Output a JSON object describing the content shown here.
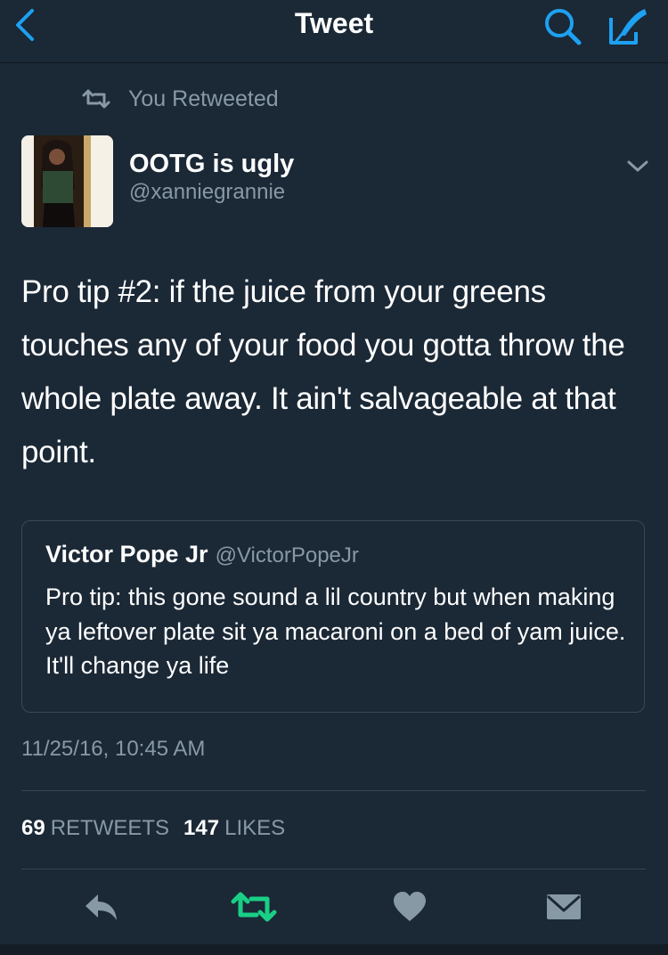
{
  "nav": {
    "title": "Tweet",
    "back_icon": "chevron-left-icon",
    "search_icon": "search-icon",
    "compose_icon": "compose-icon"
  },
  "retweet_context": {
    "text": "You Retweeted",
    "icon": "retweet-icon"
  },
  "tweet": {
    "author_name": "OOTG is ugly",
    "author_handle": "@xanniegrannie",
    "text": "Pro tip #2: if the juice from your greens touches any of your food you gotta throw the whole plate away. It ain't salvageable at that point.",
    "timestamp": "11/25/16, 10:45 AM"
  },
  "quoted_tweet": {
    "author_name": "Victor Pope Jr",
    "author_handle": "@VictorPopeJr",
    "text": "Pro tip: this gone sound a lil country but when making ya leftover plate sit ya macaroni on a bed of yam juice. It'll change ya life"
  },
  "stats": {
    "retweets_count": "69",
    "retweets_label": "RETWEETS",
    "likes_count": "147",
    "likes_label": "LIKES"
  },
  "actions": [
    "reply-icon",
    "retweet-icon",
    "like-icon",
    "direct-message-icon"
  ],
  "colors": {
    "background": "#1b2836",
    "accent": "#1da1f2",
    "retweeted_green": "#19cf86",
    "secondary_text": "#8899a6",
    "divider": "#38444d"
  }
}
